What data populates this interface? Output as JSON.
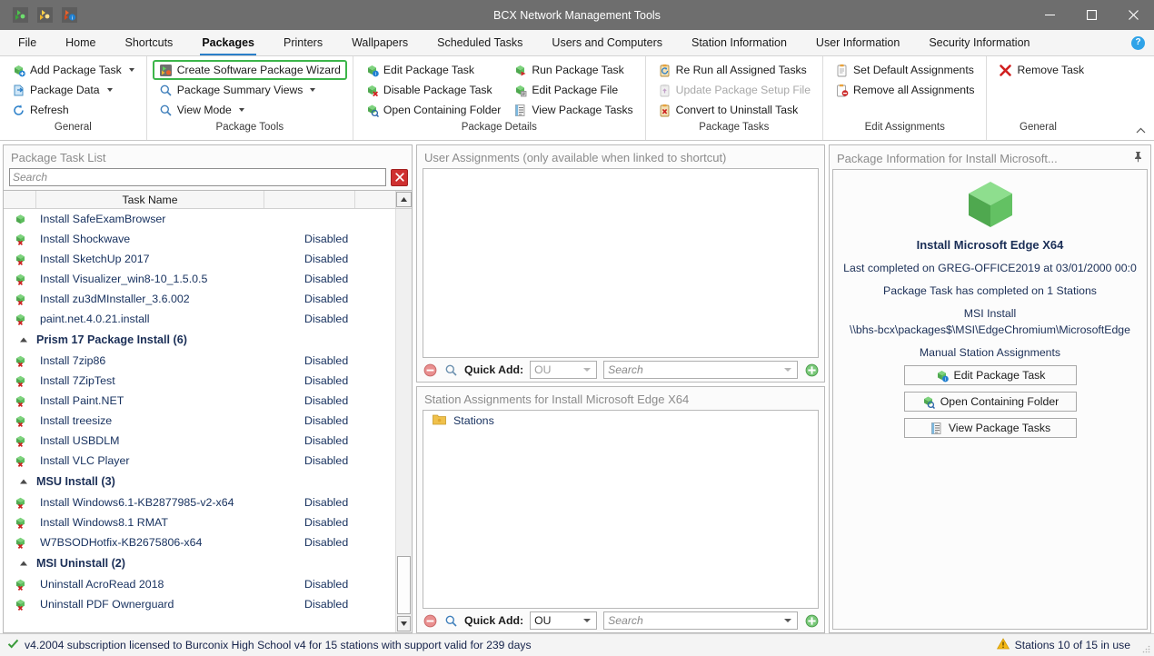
{
  "window": {
    "title": "BCX Network Management Tools",
    "quick_access": [
      "add-package-icon",
      "package-wizard-icon",
      "package-info-icon"
    ],
    "controls": {
      "minimize": "minimize-icon",
      "maximize": "maximize-icon",
      "close": "close-icon"
    }
  },
  "tabs": [
    {
      "label": "File",
      "active": false
    },
    {
      "label": "Home",
      "active": false
    },
    {
      "label": "Shortcuts",
      "active": false
    },
    {
      "label": "Packages",
      "active": true
    },
    {
      "label": "Printers",
      "active": false
    },
    {
      "label": "Wallpapers",
      "active": false
    },
    {
      "label": "Scheduled Tasks",
      "active": false
    },
    {
      "label": "Users and Computers",
      "active": false
    },
    {
      "label": "Station Information",
      "active": false
    },
    {
      "label": "User Information",
      "active": false
    },
    {
      "label": "Security Information",
      "active": false
    }
  ],
  "help": {
    "label": "?"
  },
  "ribbon": {
    "groups": [
      {
        "label": "General",
        "columns": [
          [
            {
              "text": "Add Package Task",
              "icon": "add-package-icon",
              "dropdown": true,
              "disabled": false,
              "highlight": false
            },
            {
              "text": "Package Data",
              "icon": "package-data-icon",
              "dropdown": true,
              "disabled": false,
              "highlight": false
            },
            {
              "text": "Refresh",
              "icon": "refresh-icon",
              "dropdown": false,
              "disabled": false,
              "highlight": false
            }
          ]
        ]
      },
      {
        "label": "Package Tools",
        "columns": [
          [
            {
              "text": "Create Software Package Wizard",
              "icon": "wizard-icon",
              "dropdown": false,
              "disabled": false,
              "highlight": true
            },
            {
              "text": "Package Summary Views",
              "icon": "magnifier-icon",
              "dropdown": true,
              "disabled": false,
              "highlight": false
            },
            {
              "text": "View Mode",
              "icon": "magnifier-icon",
              "dropdown": true,
              "disabled": false,
              "highlight": false
            }
          ]
        ]
      },
      {
        "label": "Package Details",
        "columns": [
          [
            {
              "text": "Edit Package Task",
              "icon": "edit-package-icon",
              "dropdown": false,
              "disabled": false,
              "highlight": false
            },
            {
              "text": "Disable Package Task",
              "icon": "disable-package-icon",
              "dropdown": false,
              "disabled": false,
              "highlight": false
            },
            {
              "text": "Open Containing Folder",
              "icon": "open-folder-icon",
              "dropdown": false,
              "disabled": false,
              "highlight": false
            }
          ],
          [
            {
              "text": "Run Package Task",
              "icon": "run-package-icon",
              "dropdown": false,
              "disabled": false,
              "highlight": false
            },
            {
              "text": "Edit Package File",
              "icon": "edit-file-icon",
              "dropdown": false,
              "disabled": false,
              "highlight": false
            },
            {
              "text": "View Package Tasks",
              "icon": "view-tasks-icon",
              "dropdown": false,
              "disabled": false,
              "highlight": false
            }
          ]
        ]
      },
      {
        "label": "Package Tasks",
        "columns": [
          [
            {
              "text": "Re Run all Assigned Tasks",
              "icon": "rerun-icon",
              "dropdown": false,
              "disabled": false,
              "highlight": false
            },
            {
              "text": "Update Package Setup File",
              "icon": "update-setup-icon",
              "dropdown": false,
              "disabled": true,
              "highlight": false
            },
            {
              "text": "Convert to Uninstall Task",
              "icon": "convert-uninstall-icon",
              "dropdown": false,
              "disabled": false,
              "highlight": false
            }
          ]
        ]
      },
      {
        "label": "Edit Assignments",
        "columns": [
          [
            {
              "text": "Set Default Assignments",
              "icon": "clipboard-icon",
              "dropdown": false,
              "disabled": false,
              "highlight": false
            },
            {
              "text": "Remove all Assignments",
              "icon": "clipboard-remove-icon",
              "dropdown": false,
              "disabled": false,
              "highlight": false
            }
          ]
        ]
      },
      {
        "label": "General",
        "columns": [
          [
            {
              "text": "Remove Task",
              "icon": "remove-x-icon",
              "dropdown": false,
              "disabled": false,
              "highlight": false
            }
          ]
        ]
      }
    ],
    "collapse": "collapse-ribbon-icon"
  },
  "left_panel": {
    "title": "Package Task List",
    "search": {
      "value": "",
      "placeholder": "Search"
    },
    "clear_label": "✕",
    "columns": [
      "",
      "Task Name",
      "",
      ""
    ],
    "rows": [
      {
        "type": "task",
        "name": "Install SafeExamBrowser",
        "status": "",
        "icon": "package-ok-icon"
      },
      {
        "type": "task",
        "name": "Install Shockwave",
        "status": "Disabled",
        "icon": "package-disabled-icon"
      },
      {
        "type": "task",
        "name": "Install SketchUp 2017",
        "status": "Disabled",
        "icon": "package-disabled-icon"
      },
      {
        "type": "task",
        "name": "Install Visualizer_win8-10_1.5.0.5",
        "status": "Disabled",
        "icon": "package-disabled-icon"
      },
      {
        "type": "task",
        "name": "Install zu3dMInstaller_3.6.002",
        "status": "Disabled",
        "icon": "package-disabled-icon"
      },
      {
        "type": "task",
        "name": "paint.net.4.0.21.install",
        "status": "Disabled",
        "icon": "package-disabled-icon"
      },
      {
        "type": "group",
        "name": "Prism 17 Package Install  (6)",
        "status": "",
        "icon": "expander-icon"
      },
      {
        "type": "task",
        "name": "Install 7zip86",
        "status": "Disabled",
        "icon": "package-disabled-icon"
      },
      {
        "type": "task",
        "name": "Install 7ZipTest",
        "status": "Disabled",
        "icon": "package-disabled-icon"
      },
      {
        "type": "task",
        "name": "Install Paint.NET",
        "status": "Disabled",
        "icon": "package-disabled-icon"
      },
      {
        "type": "task",
        "name": "Install treesize",
        "status": "Disabled",
        "icon": "package-disabled-icon"
      },
      {
        "type": "task",
        "name": "Install USBDLM",
        "status": "Disabled",
        "icon": "package-disabled-icon"
      },
      {
        "type": "task",
        "name": "Install VLC Player",
        "status": "Disabled",
        "icon": "package-disabled-icon"
      },
      {
        "type": "group",
        "name": "MSU Install  (3)",
        "status": "",
        "icon": "expander-icon"
      },
      {
        "type": "task",
        "name": "Install Windows6.1-KB2877985-v2-x64",
        "status": "Disabled",
        "icon": "package-disabled-icon"
      },
      {
        "type": "task",
        "name": "Install Windows8.1 RMAT",
        "status": "Disabled",
        "icon": "package-disabled-icon"
      },
      {
        "type": "task",
        "name": "W7BSODHotfix-KB2675806-x64",
        "status": "Disabled",
        "icon": "package-disabled-icon"
      },
      {
        "type": "group",
        "name": "MSI Uninstall  (2)",
        "status": "",
        "icon": "expander-icon"
      },
      {
        "type": "task",
        "name": "Uninstall AcroRead 2018",
        "status": "Disabled",
        "icon": "package-disabled-icon"
      },
      {
        "type": "task",
        "name": "Uninstall PDF Ownerguard",
        "status": "Disabled",
        "icon": "package-disabled-icon"
      }
    ]
  },
  "center_panel": {
    "user_assignments": {
      "title": "User Assignments (only available when linked to shortcut)",
      "items": [],
      "quick_add": {
        "label": "Quick Add:",
        "remove_icon": "remove-circle-icon",
        "search_icon": "magnifier-icon",
        "ou_value": "OU",
        "search_placeholder": "Search",
        "add_icon": "add-circle-icon",
        "enabled": false
      }
    },
    "station_assignments": {
      "title": "Station Assignments for Install Microsoft Edge X64",
      "items": [
        {
          "label": "Stations",
          "icon": "folder-icon"
        }
      ],
      "quick_add": {
        "label": "Quick Add:",
        "remove_icon": "remove-circle-icon",
        "search_icon": "magnifier-icon",
        "ou_value": "OU",
        "search_placeholder": "Search",
        "add_icon": "add-circle-icon",
        "enabled": true
      }
    }
  },
  "right_panel": {
    "title": "Package Information for Install Microsoft...",
    "pin_icon": "pin-icon",
    "package_icon": "package-cube-icon",
    "package_name": "Install Microsoft Edge X64",
    "last_completed": "Last completed on GREG-OFFICE2019 at 03/01/2000 00:0",
    "completed_stations": "Package Task has completed on 1 Stations",
    "install_type": "MSI Install",
    "path": "\\\\bhs-bcx\\packages$\\MSI\\EdgeChromium\\MicrosoftEdge",
    "assignment_mode": "Manual Station Assignments",
    "buttons": [
      {
        "label": "Edit Package Task",
        "icon": "edit-package-icon"
      },
      {
        "label": "Open Containing Folder",
        "icon": "open-folder-icon"
      },
      {
        "label": "View Package Tasks",
        "icon": "view-tasks-icon"
      }
    ]
  },
  "status_bar": {
    "left_icon": "check-icon",
    "left_text": "v4.2004 subscription licensed to Burconix High School v4 for 15 stations with support valid for 239 days",
    "right_icon": "warning-icon",
    "right_text": "Stations 10 of 15 in use"
  }
}
